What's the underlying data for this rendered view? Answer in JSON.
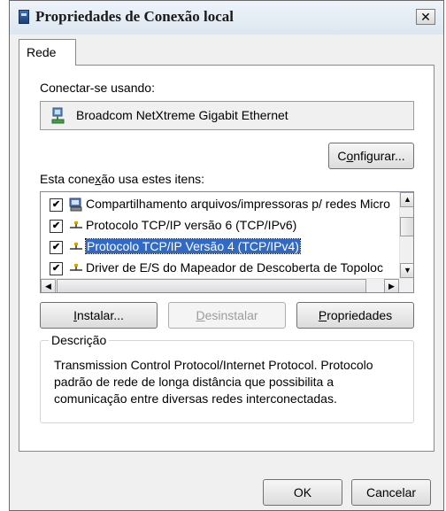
{
  "window": {
    "title": "Propriedades de Conexão local",
    "close_symbol": "✕"
  },
  "tabs": [
    {
      "label": "Rede",
      "selected": true
    }
  ],
  "connect_using": {
    "label": "Conectar-se usando:",
    "adapter_name": "Broadcom NetXtreme Gigabit Ethernet",
    "adapter_icon": "network-adapter-icon"
  },
  "configure_button": {
    "label_pre": "C",
    "label_u": "o",
    "label_post": "nfigurar..."
  },
  "items_section": {
    "label_pre": "Esta cone",
    "label_u": "x",
    "label_post": "ão usa estes itens:"
  },
  "items": [
    {
      "label": "Compartilhamento arquivos/impressoras p/ redes Micro",
      "checked": true,
      "icon": "network-share-icon",
      "selected": false
    },
    {
      "label": "Protocolo TCP/IP versão 6 (TCP/IPv6)",
      "checked": true,
      "icon": "protocol-icon",
      "selected": false
    },
    {
      "label": "Protocolo TCP/IP Versão 4 (TCP/IPv4)",
      "checked": true,
      "icon": "protocol-icon",
      "selected": true
    },
    {
      "label": "Driver de E/S do Mapeador de Descoberta de Topoloc",
      "checked": true,
      "icon": "protocol-icon",
      "selected": false
    }
  ],
  "buttons": {
    "install": {
      "label_u": "I",
      "label_post": "nstalar..."
    },
    "uninstall": {
      "label_u": "D",
      "label_post": "esinstalar",
      "enabled": false
    },
    "properties": {
      "label_u": "P",
      "label_post": "ropriedades"
    }
  },
  "description": {
    "legend": "Descrição",
    "text": "Transmission Control Protocol/Internet Protocol. Protocolo padrão de rede de longa distância que possibilita a comunicação entre diversas redes interconectadas."
  },
  "footer": {
    "ok_label": "OK",
    "cancel_label": "Cancelar"
  },
  "colors": {
    "selection": "#3169c6",
    "dialog_bg": "#f0f0f0",
    "panel_bg": "#ffffff"
  }
}
